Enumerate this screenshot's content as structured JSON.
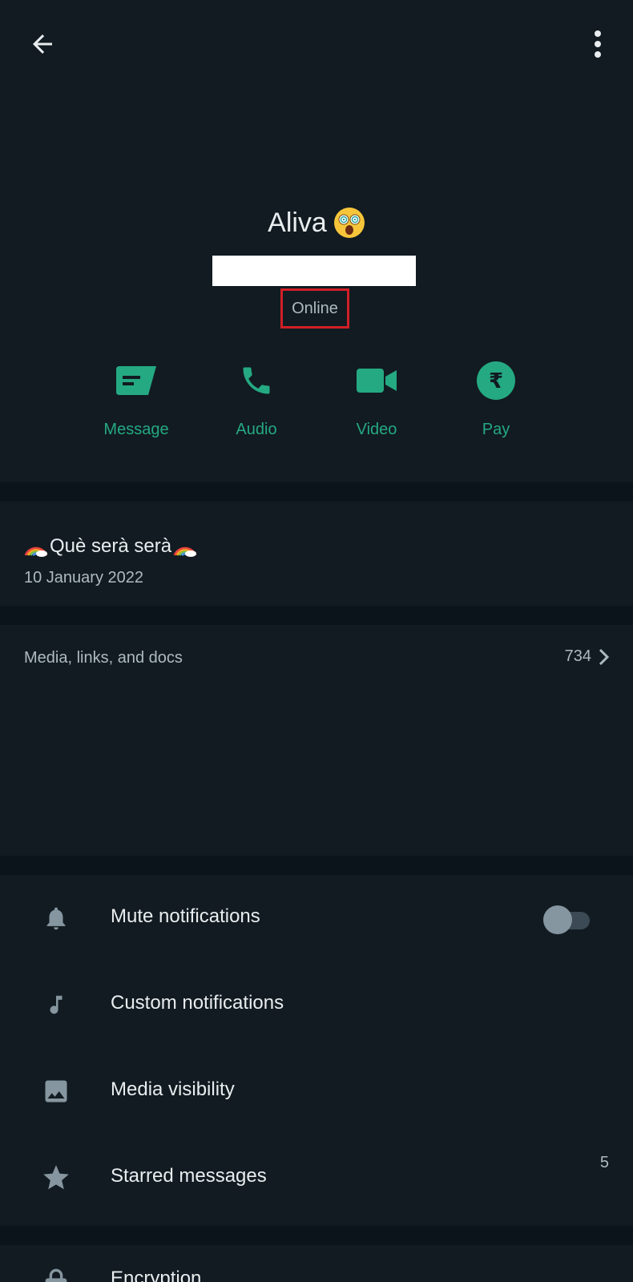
{
  "topbar": {
    "back_icon": "arrow-left-icon",
    "menu_icon": "more-vertical-icon"
  },
  "profile": {
    "name": "Aliva",
    "name_emoji": "dizzy-face-emoji",
    "status": "Online"
  },
  "actions": [
    {
      "label": "Message",
      "icon": "message-icon"
    },
    {
      "label": "Audio",
      "icon": "phone-icon"
    },
    {
      "label": "Video",
      "icon": "video-icon"
    },
    {
      "label": "Pay",
      "icon": "rupee-icon"
    }
  ],
  "about": {
    "text": "Què serà serà",
    "date": "10 January 2022"
  },
  "media": {
    "title": "Media, links, and docs",
    "count": "734"
  },
  "settings": {
    "mute": {
      "label": "Mute notifications",
      "icon": "bell-icon",
      "enabled": false
    },
    "custom": {
      "label": "Custom notifications",
      "icon": "music-note-icon"
    },
    "visibility": {
      "label": "Media visibility",
      "icon": "image-icon"
    },
    "starred": {
      "label": "Starred messages",
      "icon": "star-icon",
      "count": "5"
    },
    "encryption": {
      "label": "Encryption",
      "icon": "lock-icon"
    }
  },
  "colors": {
    "background": "#111b21",
    "divider": "#0b141a",
    "accent": "#25a982",
    "text_primary": "#e9edef",
    "text_secondary": "#aebac1",
    "highlight_box": "#d11f26"
  }
}
